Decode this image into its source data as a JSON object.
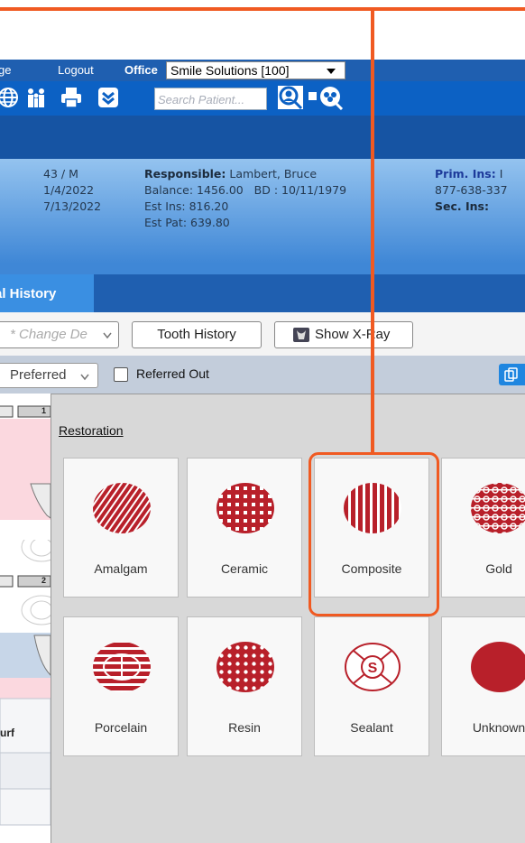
{
  "topnav": {
    "clip_left": "ge",
    "logout": "Logout",
    "office_label": "Office",
    "office_value": "Smile Solutions [100]"
  },
  "toolbar": {
    "icons": [
      "globe-icon",
      "family-icon",
      "print-icon",
      "expand-icon",
      "patient-search-icon",
      "group-search-icon"
    ],
    "search_placeholder": "Search Patient..."
  },
  "patient": {
    "age_sex": "43 / M",
    "date1": "1/4/2022",
    "date2": "7/13/2022",
    "responsible_label": "Responsible:",
    "responsible_value": "Lambert, Bruce",
    "balance": "Balance: 1456.00",
    "bd": "BD : 10/11/1979",
    "est_ins": "Est Ins:  816.20",
    "est_pat": "Est Pat: 639.80",
    "prim_ins_label": "Prim. Ins:",
    "prim_ins_clip": "I",
    "phone": "877-638-337",
    "sec_ins_label": "Sec. Ins:"
  },
  "tabs": {
    "active": "al History"
  },
  "buttons": {
    "change": "* Change De",
    "tooth_history": "Tooth History",
    "show_xray": "Show X-Ray"
  },
  "filters": {
    "preferred": "Preferred",
    "referred_out": "Referred Out"
  },
  "left_chart": {
    "clip_label": "urf",
    "tooth_numbers": [
      "1",
      "2"
    ]
  },
  "panel": {
    "title": "Restoration",
    "materials": [
      {
        "label": "Amalgam",
        "icon": "amalgam-icon"
      },
      {
        "label": "Ceramic",
        "icon": "ceramic-icon"
      },
      {
        "label": "Composite",
        "icon": "composite-icon"
      },
      {
        "label": "Gold",
        "icon": "gold-icon"
      },
      {
        "label": "Porcelain",
        "icon": "porcelain-icon"
      },
      {
        "label": "Resin",
        "icon": "resin-icon"
      },
      {
        "label": "Sealant",
        "icon": "sealant-icon"
      },
      {
        "label": "Unknown",
        "icon": "unknown-icon"
      }
    ]
  },
  "colors": {
    "nav_blue": "#1f5fb0",
    "toolbar_blue": "#0c61c4",
    "material_red": "#b8202a",
    "callout_orange": "#f05a22"
  },
  "highlight": "Composite"
}
